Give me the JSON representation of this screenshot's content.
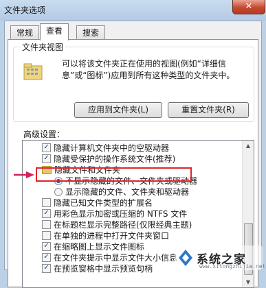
{
  "window": {
    "title": "文件夹选项",
    "close_glyph": "✕"
  },
  "tabs": [
    {
      "label": "常规",
      "active": false
    },
    {
      "label": "查看",
      "active": true
    },
    {
      "label": "搜索",
      "active": false
    }
  ],
  "folder_views": {
    "title": "文件夹视图",
    "description": "可以将该文件夹正在使用的视图(例如“详细信息”或“图标”)应用到所有这种类型的文件夹中。",
    "apply_button": "应用到文件夹(L)",
    "reset_button": "重置文件夹(R)"
  },
  "advanced": {
    "label": "高级设置：",
    "items": [
      {
        "type": "checkbox",
        "checked": true,
        "label": "隐藏计算机文件夹中的空驱动器"
      },
      {
        "type": "checkbox",
        "checked": true,
        "label": "隐藏受保护的操作系统文件(推荐)"
      },
      {
        "type": "folder",
        "label": "隐藏文件和文件夹"
      },
      {
        "type": "radio",
        "checked": true,
        "label": "不显示隐藏的文件、文件夹或驱动器"
      },
      {
        "type": "radio",
        "checked": false,
        "label": "显示隐藏的文件、文件夹和驱动器"
      },
      {
        "type": "checkbox",
        "checked": false,
        "label": "隐藏已知文件类型的扩展名"
      },
      {
        "type": "checkbox",
        "checked": true,
        "label": "用彩色显示加密或压缩的 NTFS 文件"
      },
      {
        "type": "checkbox",
        "checked": false,
        "label": "在标题栏显示完整路径(仅限经典主题)"
      },
      {
        "type": "checkbox",
        "checked": false,
        "label": "在单独的进程中打开文件夹窗口"
      },
      {
        "type": "checkbox",
        "checked": true,
        "label": "在缩略图上显示文件图标"
      },
      {
        "type": "checkbox",
        "checked": true,
        "label": "在文件夹提示中显示文件大小信息"
      },
      {
        "type": "checkbox",
        "checked": true,
        "label": "在预览窗格中显示预览句柄"
      }
    ]
  },
  "watermark": {
    "text": "系统之家",
    "url": "www.xitongzhijia.net"
  },
  "colors": {
    "highlight": "#e0242a",
    "arrow": "#d81f5a"
  }
}
